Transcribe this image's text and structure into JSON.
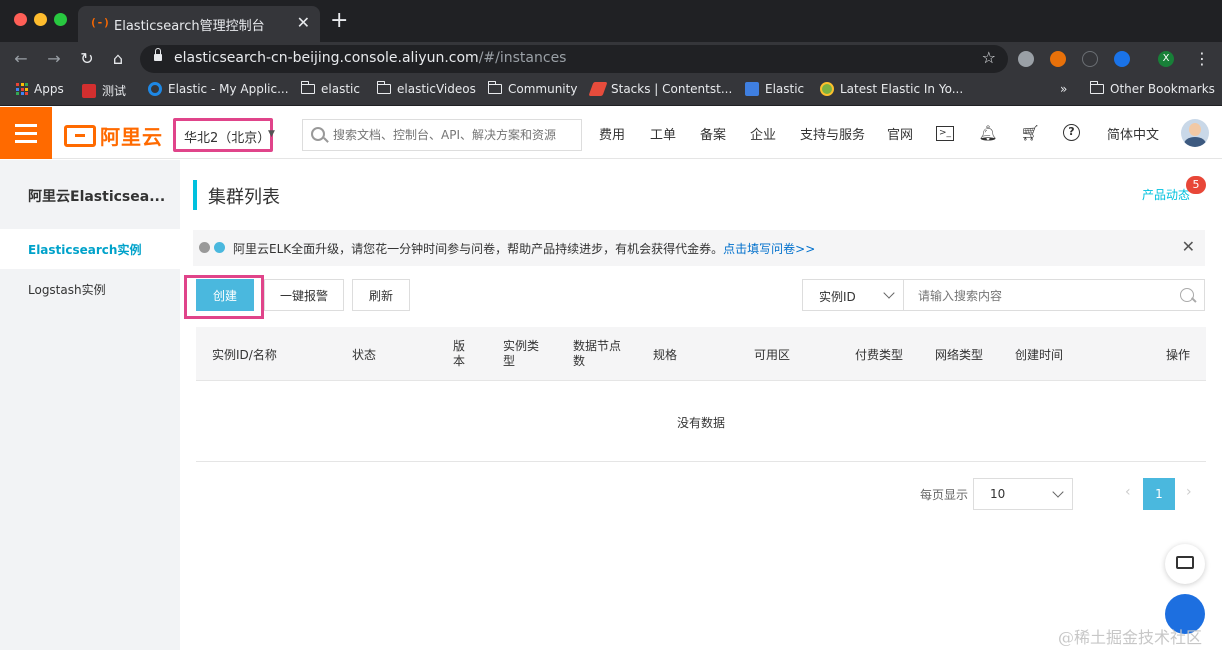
{
  "browser": {
    "tab_title": "Elasticsearch管理控制台",
    "tab_favicon": "(-)",
    "url_host": "elasticsearch-cn-beijing.console.aliyun.com",
    "url_path": "/#/instances",
    "bookmarks": [
      {
        "label": "Apps"
      },
      {
        "label": "测试"
      },
      {
        "label": "Elastic - My Applic..."
      },
      {
        "label": "elastic"
      },
      {
        "label": "elasticVideos"
      },
      {
        "label": "Community"
      },
      {
        "label": "Stacks | Contentst..."
      },
      {
        "label": "Elastic"
      },
      {
        "label": "Latest Elastic In Yo..."
      }
    ],
    "bookmarks_overflow": "»",
    "other_bookmarks": "Other Bookmarks",
    "profile_initial": "X"
  },
  "topnav": {
    "logo_text": "阿里云",
    "region": "华北2（北京）",
    "search_placeholder": "搜索文档、控制台、API、解决方案和资源",
    "menu": [
      "费用",
      "工单",
      "备案",
      "企业",
      "支持与服务",
      "官网"
    ],
    "language": "简体中文"
  },
  "sidebar": {
    "title": "阿里云Elasticsea...",
    "items": [
      {
        "label": "Elasticsearch实例",
        "active": true
      },
      {
        "label": "Logstash实例",
        "active": false
      }
    ]
  },
  "main": {
    "page_title": "集群列表",
    "news_label": "产品动态",
    "news_badge": "5",
    "notice_text": "阿里云ELK全面升级，请您花一分钟时间参与问卷，帮助产品持续进步，有机会获得代金券。",
    "notice_link": "点击填写问卷>>",
    "buttons": {
      "create": "创建",
      "alert": "一键报警",
      "refresh": "刷新"
    },
    "filter": {
      "field": "实例ID",
      "placeholder": "请输入搜索内容"
    },
    "table": {
      "columns": [
        "实例ID/名称",
        "状态",
        "版本",
        "实例类型",
        "数据节点数",
        "规格",
        "可用区",
        "付费类型",
        "网络类型",
        "创建时间",
        "操作"
      ],
      "empty_text": "没有数据"
    },
    "pagination": {
      "page_size_label": "每页显示",
      "page_size": "10",
      "current_page": "1",
      "prev": "‹",
      "next": "›"
    }
  },
  "watermark": "@稀土掘金技术社区",
  "colors": {
    "brand": "#ff6a00",
    "primary": "#4ab8de",
    "highlight": "#e0448a",
    "link": "#0070cc"
  }
}
